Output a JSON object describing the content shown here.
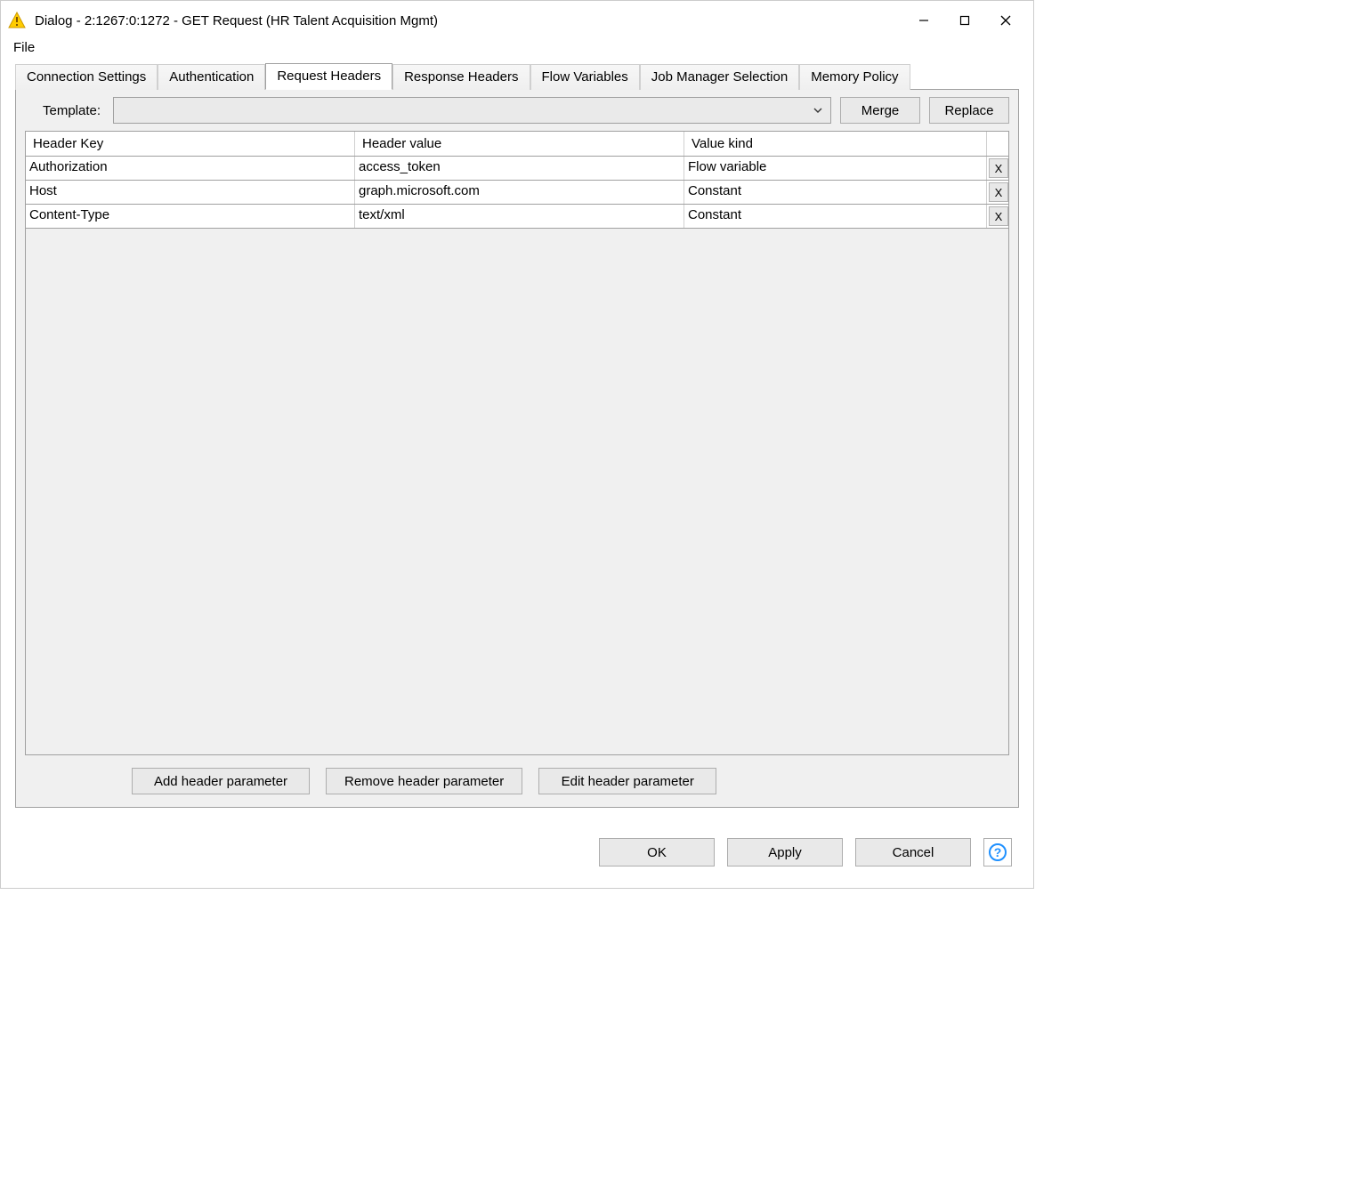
{
  "titlebar": {
    "title": "Dialog - 2:1267:0:1272 - GET Request (HR Talent Acquisition Mgmt)"
  },
  "menubar": {
    "file": "File"
  },
  "tabs": [
    {
      "label": "Connection Settings",
      "active": false
    },
    {
      "label": "Authentication",
      "active": false
    },
    {
      "label": "Request Headers",
      "active": true
    },
    {
      "label": "Response Headers",
      "active": false
    },
    {
      "label": "Flow Variables",
      "active": false
    },
    {
      "label": "Job Manager Selection",
      "active": false
    },
    {
      "label": "Memory Policy",
      "active": false
    }
  ],
  "template_row": {
    "label": "Template:",
    "merge": "Merge",
    "replace": "Replace"
  },
  "table": {
    "columns": {
      "key": "Header Key",
      "value": "Header value",
      "kind": "Value kind"
    },
    "rows": [
      {
        "key": "Authorization",
        "value": "access_token",
        "kind": "Flow variable"
      },
      {
        "key": "Host",
        "value": "graph.microsoft.com",
        "kind": "Constant"
      },
      {
        "key": "Content-Type",
        "value": "text/xml",
        "kind": "Constant"
      }
    ],
    "delete_glyph": "X"
  },
  "table_actions": {
    "add": "Add header parameter",
    "remove": "Remove header parameter",
    "edit": "Edit header parameter"
  },
  "footer": {
    "ok": "OK",
    "apply": "Apply",
    "cancel": "Cancel"
  }
}
